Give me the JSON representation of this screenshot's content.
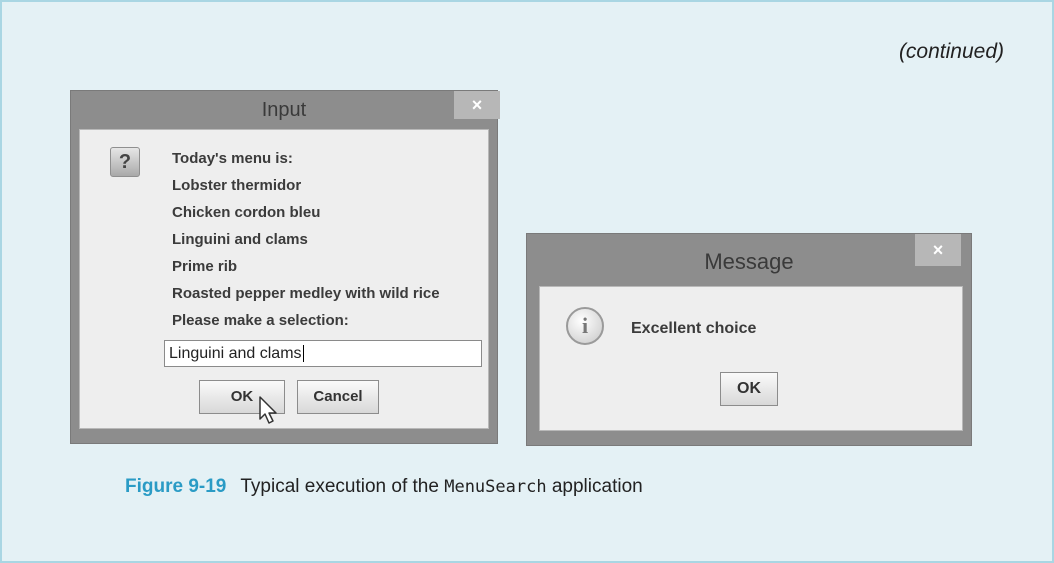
{
  "continued_label": "(continued)",
  "input_dialog": {
    "title": "Input",
    "close_symbol": "×",
    "icon_symbol": "?",
    "lines": [
      "Today's menu is:",
      "Lobster thermidor",
      "Chicken cordon bleu",
      "Linguini and clams",
      "Prime rib",
      "Roasted pepper medley with wild rice",
      "Please make a selection:"
    ],
    "input_value": "Linguini and clams",
    "ok_label": "OK",
    "cancel_label": "Cancel"
  },
  "message_dialog": {
    "title": "Message",
    "close_symbol": "×",
    "icon_symbol": "i",
    "message": "Excellent choice",
    "ok_label": "OK"
  },
  "caption": {
    "figure_number": "Figure 9-19",
    "text_before": "Typical execution of the ",
    "code": "MenuSearch",
    "text_after": " application"
  }
}
